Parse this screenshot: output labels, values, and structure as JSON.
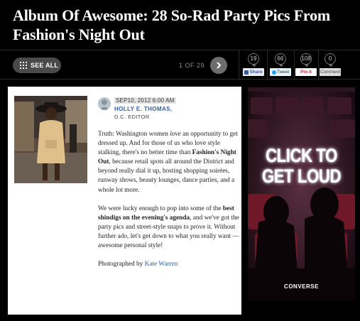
{
  "headline": {
    "line1": "Album Of Awesome: 28 So-Rad Party Pics From",
    "line2": "Fashion's Night Out"
  },
  "toolbar": {
    "see_all_label": "SEE ALL",
    "pager": "1 OF 29"
  },
  "share": [
    {
      "count": "19",
      "label": "Share",
      "icon": "facebook-icon",
      "color": "#3b5998"
    },
    {
      "count": "66",
      "label": "Tweet",
      "icon": "twitter-icon",
      "color": "#1da1f2"
    },
    {
      "count": "108",
      "label": "Pin it",
      "icon": "pinterest-icon",
      "color": "#c8232c"
    },
    {
      "count": "0",
      "label": "Comment",
      "icon": "comment-icon",
      "color": "#666666"
    }
  ],
  "byline": {
    "date": "SEP10, 2012 6:00 AM",
    "author": "HOLLY E. THOMAS,",
    "role": "D.C. EDITOR"
  },
  "body": {
    "p1_a": "Truth: Washington women ",
    "p1_b": "love",
    "p1_c": " an opportunity to get dressed up. And for those of us who love style stalking, there's no better time than ",
    "p1_d": "Fashion's Night Out",
    "p1_e": ", because retail spots all around the District and beyond really dial it up, hosting shopping soirées, runway shows, beauty lounges, dance parties, and a whole lot more.",
    "p2_a": "We were lucky enough to pop into some of the ",
    "p2_b": "best shindigs on the evening's agenda",
    "p2_c": ", and we've got the party pics and street-style snaps to prove it. Without further ado, let's get down to what you really want — awesome personal style!",
    "credit_prefix": "Photographed by ",
    "credit_name": "Kate Warren"
  },
  "ad": {
    "line1": "CLICK TO",
    "line2": "GET LOUD",
    "brand": "CONVERSE"
  },
  "colors": {
    "page_bg": "#000000",
    "link": "#2f5f9e",
    "ad_bg": "#1a0a12"
  }
}
